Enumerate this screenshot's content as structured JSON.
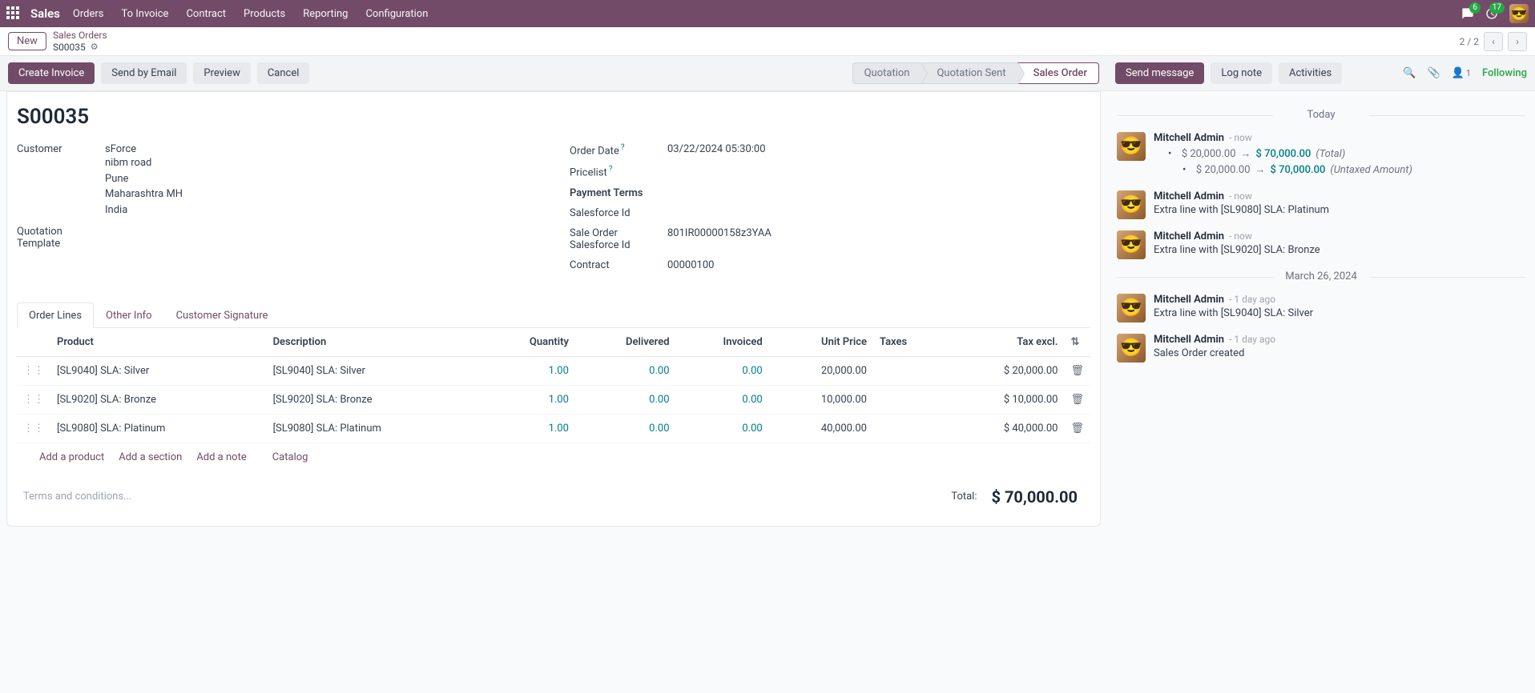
{
  "topbar": {
    "brand": "Sales",
    "menu": [
      "Orders",
      "To Invoice",
      "Contract",
      "Products",
      "Reporting",
      "Configuration"
    ],
    "chat_count": "6",
    "activity_count": "17"
  },
  "subbar": {
    "new_btn": "New",
    "crumb_top": "Sales Orders",
    "crumb_cur": "S00035",
    "pager": "2 / 2"
  },
  "actions": {
    "create_invoice": "Create Invoice",
    "send_email": "Send by Email",
    "preview": "Preview",
    "cancel": "Cancel"
  },
  "status": {
    "quotation": "Quotation",
    "quotation_sent": "Quotation Sent",
    "sales_order": "Sales Order"
  },
  "right_actions": {
    "send_message": "Send message",
    "log_note": "Log note",
    "activities": "Activities",
    "following": "Following",
    "follower_count": "1"
  },
  "record": {
    "name": "S00035",
    "customer_label": "Customer",
    "customer": "sForce",
    "address": [
      "nibm road",
      "Pune",
      "Maharashtra MH",
      "India"
    ],
    "template_label": "Quotation Template",
    "order_date_label": "Order Date",
    "order_date": "03/22/2024 05:30:00",
    "pricelist_label": "Pricelist",
    "payment_terms_label": "Payment Terms",
    "salesforce_id_label": "Salesforce Id",
    "sf_order_label": "Sale Order Salesforce Id",
    "sf_order": "801IR00000158z3YAA",
    "contract_label": "Contract",
    "contract": "00000100"
  },
  "tabs": {
    "order_lines": "Order Lines",
    "other_info": "Other Info",
    "signature": "Customer Signature"
  },
  "table": {
    "headers": {
      "product": "Product",
      "description": "Description",
      "quantity": "Quantity",
      "delivered": "Delivered",
      "invoiced": "Invoiced",
      "unit_price": "Unit Price",
      "taxes": "Taxes",
      "tax_excl": "Tax excl."
    },
    "rows": [
      {
        "product": "[SL9040] SLA: Silver",
        "desc": "[SL9040] SLA: Silver",
        "qty": "1.00",
        "deliv": "0.00",
        "inv": "0.00",
        "price": "20,000.00",
        "taxes": "",
        "excl": "$ 20,000.00"
      },
      {
        "product": "[SL9020] SLA: Bronze",
        "desc": "[SL9020] SLA: Bronze",
        "qty": "1.00",
        "deliv": "0.00",
        "inv": "0.00",
        "price": "10,000.00",
        "taxes": "",
        "excl": "$ 10,000.00"
      },
      {
        "product": "[SL9080] SLA: Platinum",
        "desc": "[SL9080] SLA: Platinum",
        "qty": "1.00",
        "deliv": "0.00",
        "inv": "0.00",
        "price": "40,000.00",
        "taxes": "",
        "excl": "$ 40,000.00"
      }
    ],
    "add_product": "Add a product",
    "add_section": "Add a section",
    "add_note": "Add a note",
    "catalog": "Catalog",
    "terms_placeholder": "Terms and conditions...",
    "total_label": "Total:",
    "total": "$ 70,000.00"
  },
  "chatter": {
    "today": "Today",
    "prev_date": "March 26, 2024",
    "messages": {
      "m1": {
        "author": "Mitchell Admin",
        "time": "- now",
        "old1": "$ 20,000.00",
        "new1": "$ 70,000.00",
        "lbl1": "(Total)",
        "old2": "$ 20,000.00",
        "new2": "$ 70,000.00",
        "lbl2": "(Untaxed Amount)"
      },
      "m2": {
        "author": "Mitchell Admin",
        "time": "- now",
        "text": "Extra line with [SL9080] SLA: Platinum"
      },
      "m3": {
        "author": "Mitchell Admin",
        "time": "- now",
        "text": "Extra line with [SL9020] SLA: Bronze"
      },
      "m4": {
        "author": "Mitchell Admin",
        "time": "- 1 day ago",
        "text": "Extra line with [SL9040] SLA: Silver"
      },
      "m5": {
        "author": "Mitchell Admin",
        "time": "- 1 day ago",
        "text": "Sales Order created"
      }
    }
  }
}
